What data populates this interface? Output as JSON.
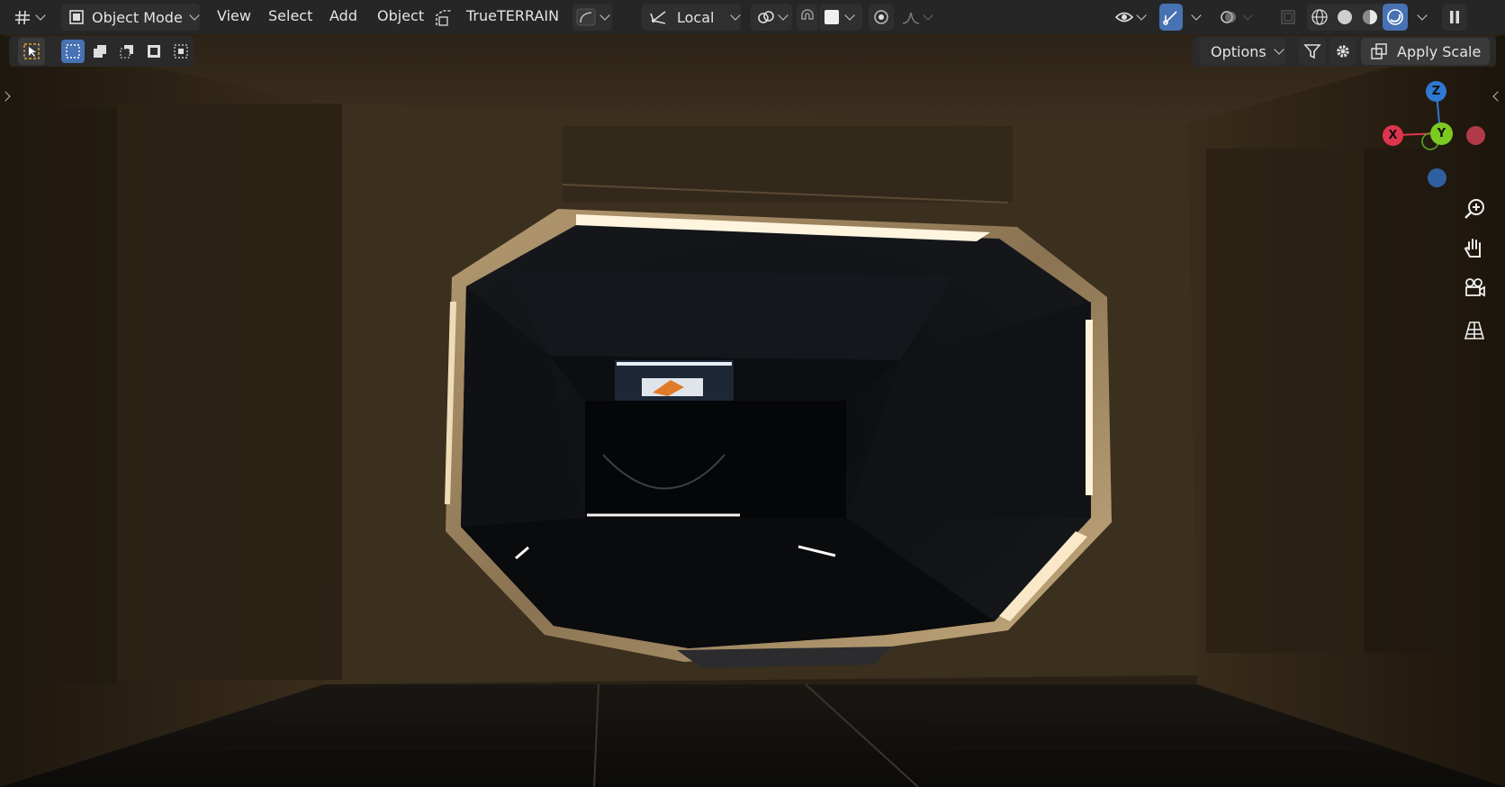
{
  "header": {
    "editor_type_icon": "viewport-editor-icon",
    "mode_label": "Object Mode",
    "menus": [
      "View",
      "Select",
      "Add",
      "Object"
    ],
    "addon_label": "TrueTERRAIN",
    "transform_orientation": "Local",
    "shading_modes": [
      "wireframe",
      "solid",
      "material-preview",
      "rendered"
    ],
    "active_shading": "rendered"
  },
  "toolbar": {
    "options_label": "Options",
    "apply_scale_label": "Apply Scale"
  },
  "gizmo": {
    "axes": [
      "Z",
      "Y",
      "X"
    ],
    "colors": {
      "x": "#e0344d",
      "y": "#7cc922",
      "z": "#2f78d3"
    }
  },
  "colors": {
    "accent": "#4772b3",
    "header_bg": "#262626",
    "viewport_wall": "#3a2e1d",
    "door_light": "#f2e3c4"
  }
}
